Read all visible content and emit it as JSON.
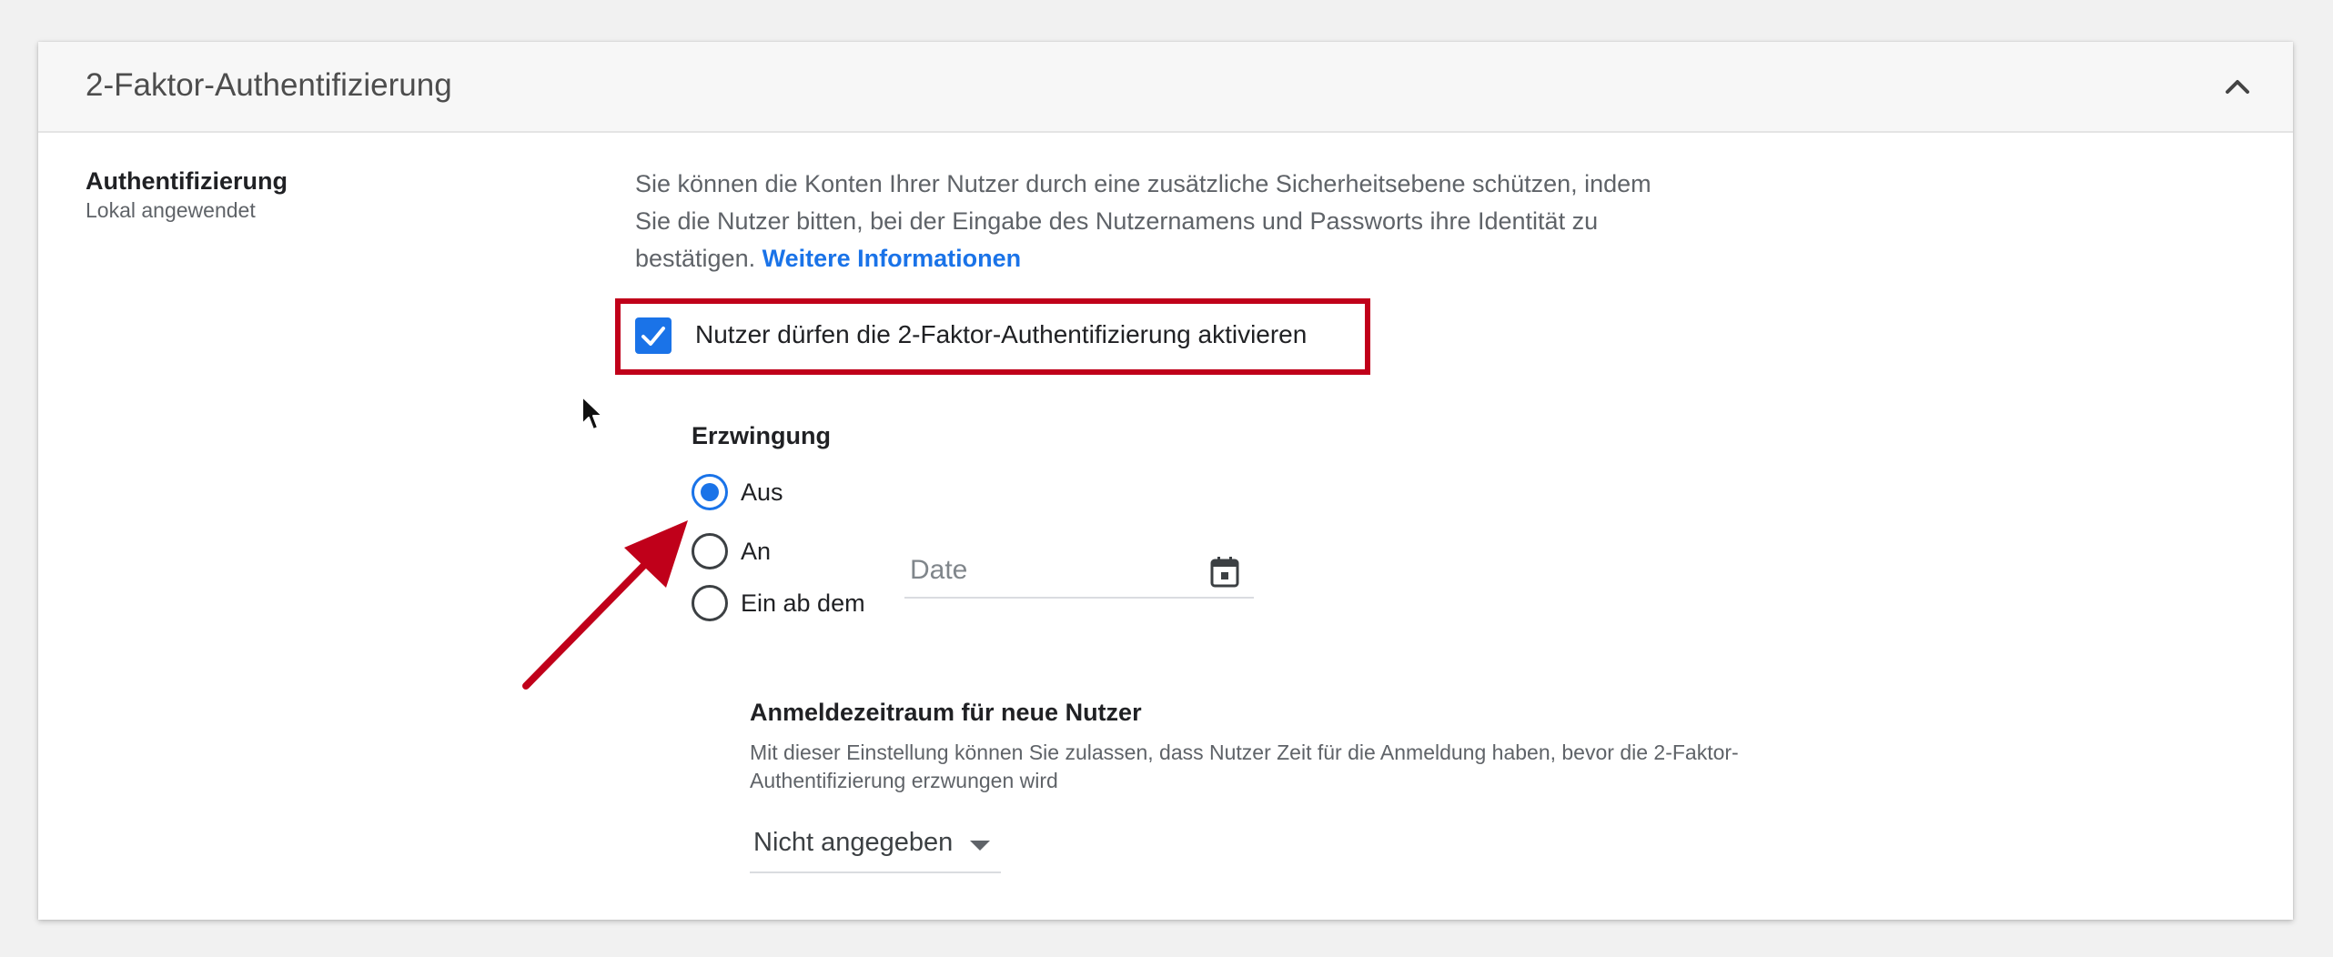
{
  "header": {
    "title": "2-Faktor-Authentifizierung"
  },
  "section": {
    "label": "Authentifizierung",
    "sublabel": "Lokal angewendet",
    "description": "Sie können die Konten Ihrer Nutzer durch eine zusätzliche Sicherheitsebene schützen, indem Sie die Nutzer bitten, bei der Eingabe des Nutzernamens und Passworts ihre Identität zu bestätigen.",
    "learn_more_link": "Weitere Informationen"
  },
  "allow_2fa": {
    "label": "Nutzer dürfen die 2-Faktor-Authentifizierung aktivieren",
    "checked": true
  },
  "enforcement": {
    "title": "Erzwingung",
    "options": [
      {
        "label": "Aus",
        "selected": true
      },
      {
        "label": "An",
        "selected": false
      },
      {
        "label": "Ein ab dem",
        "selected": false
      }
    ],
    "date_placeholder": "Date"
  },
  "new_user_period": {
    "title": "Anmeldezeitraum für neue Nutzer",
    "description": "Mit dieser Einstellung können Sie zulassen, dass Nutzer Zeit für die Anmeldung haben, bevor die 2-Faktor-Authentifizierung erzwungen wird",
    "selected_value": "Nicht angegeben"
  },
  "colors": {
    "accent_blue": "#1a73e8",
    "highlight_red": "#c0001a"
  },
  "icons": {
    "collapse": "chevron-up-icon",
    "check": "check-icon",
    "calendar": "calendar-icon",
    "dropdown": "caret-down-icon"
  }
}
